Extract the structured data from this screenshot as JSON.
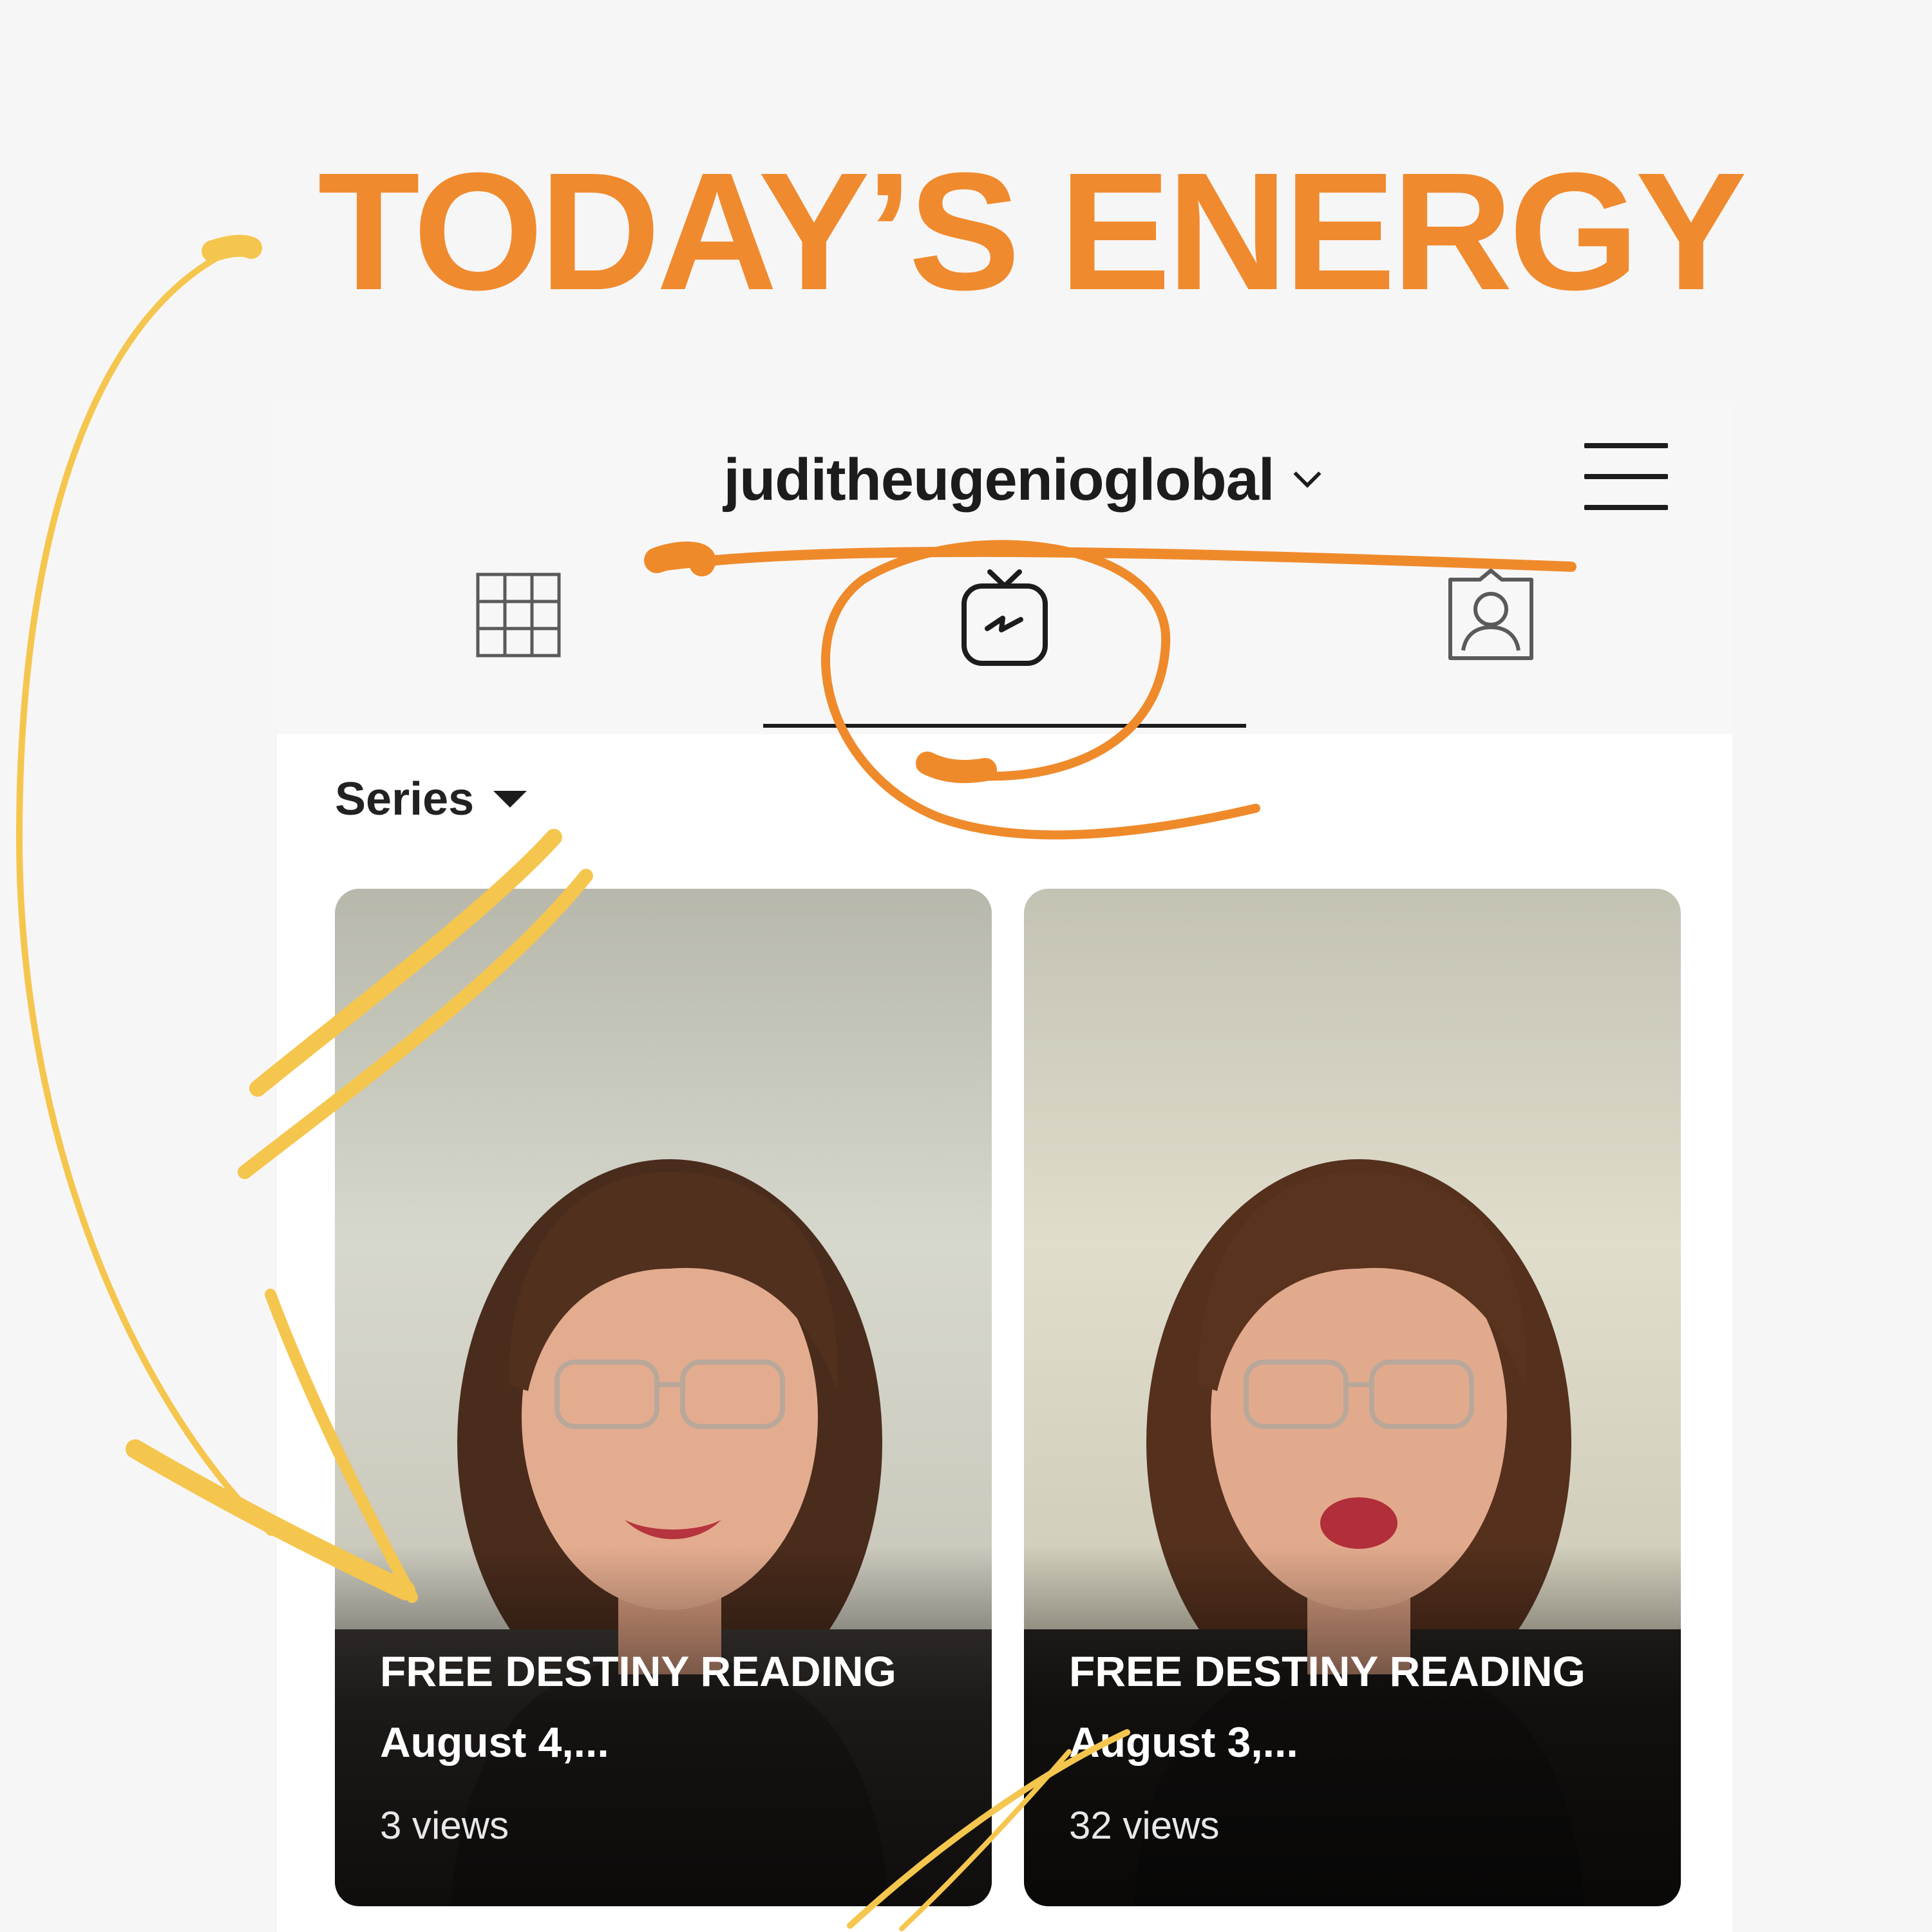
{
  "headline": {
    "text": "TODAY’S ENERGY",
    "color": "#f08a2e"
  },
  "header": {
    "username": "juditheugenioglobal"
  },
  "tabs": [
    {
      "name": "grid",
      "icon": "grid-icon",
      "active": false
    },
    {
      "name": "igtv",
      "icon": "igtv-icon",
      "active": true
    },
    {
      "name": "tagged",
      "icon": "tagged-person-icon",
      "active": false
    }
  ],
  "filter": {
    "label": "Series"
  },
  "videos": [
    {
      "title": "FREE DESTINY READING August 4,...",
      "views": "3 views"
    },
    {
      "title": "FREE DESTINY READING August 3,...",
      "views": "32 views"
    }
  ],
  "colors": {
    "annotation_orange": "#ef8a2b",
    "annotation_yellow": "#f5c64e",
    "text_dark": "#1c1c1c"
  }
}
